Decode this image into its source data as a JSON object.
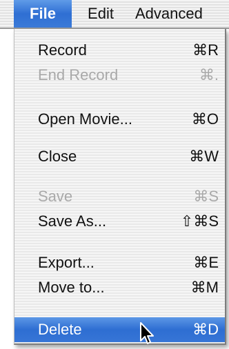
{
  "menubar": {
    "items": [
      {
        "label": "File"
      },
      {
        "label": "Edit"
      },
      {
        "label": "Advanced"
      }
    ]
  },
  "menu": {
    "items": [
      {
        "label": "Record",
        "shortcut": "⌘R",
        "enabled": true
      },
      {
        "label": "End Record",
        "shortcut": "⌘.",
        "enabled": false
      },
      {
        "label": "Open Movie...",
        "shortcut": "⌘O",
        "enabled": true
      },
      {
        "label": "Close",
        "shortcut": "⌘W",
        "enabled": true
      },
      {
        "label": "Save",
        "shortcut": "⌘S",
        "enabled": false
      },
      {
        "label": "Save As...",
        "shortcut": "⇧⌘S",
        "enabled": true
      },
      {
        "label": "Export...",
        "shortcut": "⌘E",
        "enabled": true
      },
      {
        "label": "Move to...",
        "shortcut": "⌘M",
        "enabled": true
      },
      {
        "label": "Delete",
        "shortcut": "⌘D",
        "enabled": true,
        "selected": true
      }
    ]
  },
  "colors": {
    "highlight": "#2f6fd3",
    "disabled_text": "#a9a9a9",
    "text": "#111111"
  },
  "icons": {
    "cursor": "arrow-pointer-icon"
  }
}
